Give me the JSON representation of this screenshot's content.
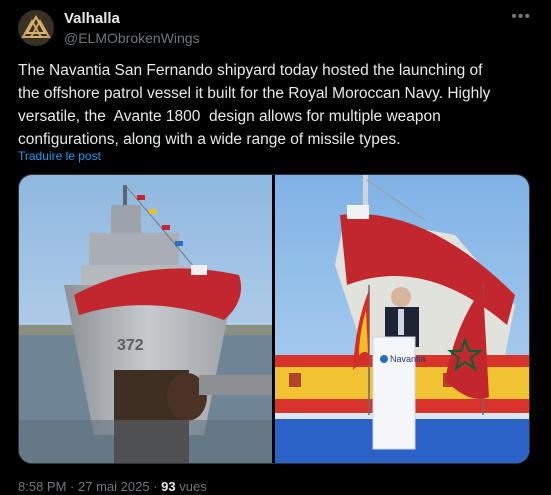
{
  "author": {
    "display_name": "Valhalla",
    "handle": "@ELMObrokenWings",
    "avatar_icon": "valknut-logo"
  },
  "menu_icon": "more-icon",
  "post": {
    "lines": [
      "The Navantia San Fernando shipyard today hosted the launching of",
      "the offshore patrol vessel it built for the Royal Moroccan Navy. Highly",
      "versatile, the  Avante 1800  design allows for multiple weapon",
      "configurations, along with a wide range of missile types."
    ],
    "translate_label": "Traduire le post"
  },
  "media": {
    "left_photo": {
      "bow_number": "372"
    },
    "right_photo": {
      "podium_brand": "Navantia"
    }
  },
  "footer": {
    "time": "8:58 PM",
    "separator": "·",
    "date": "27 mai 2025",
    "views_count": "93",
    "views_label": "vues"
  },
  "colors": {
    "background": "#000000",
    "text": "#e7e9ea",
    "secondary": "#71767b",
    "link": "#1d9bf0",
    "moroccan_red": "#c1272d",
    "moroccan_green": "#006233"
  }
}
